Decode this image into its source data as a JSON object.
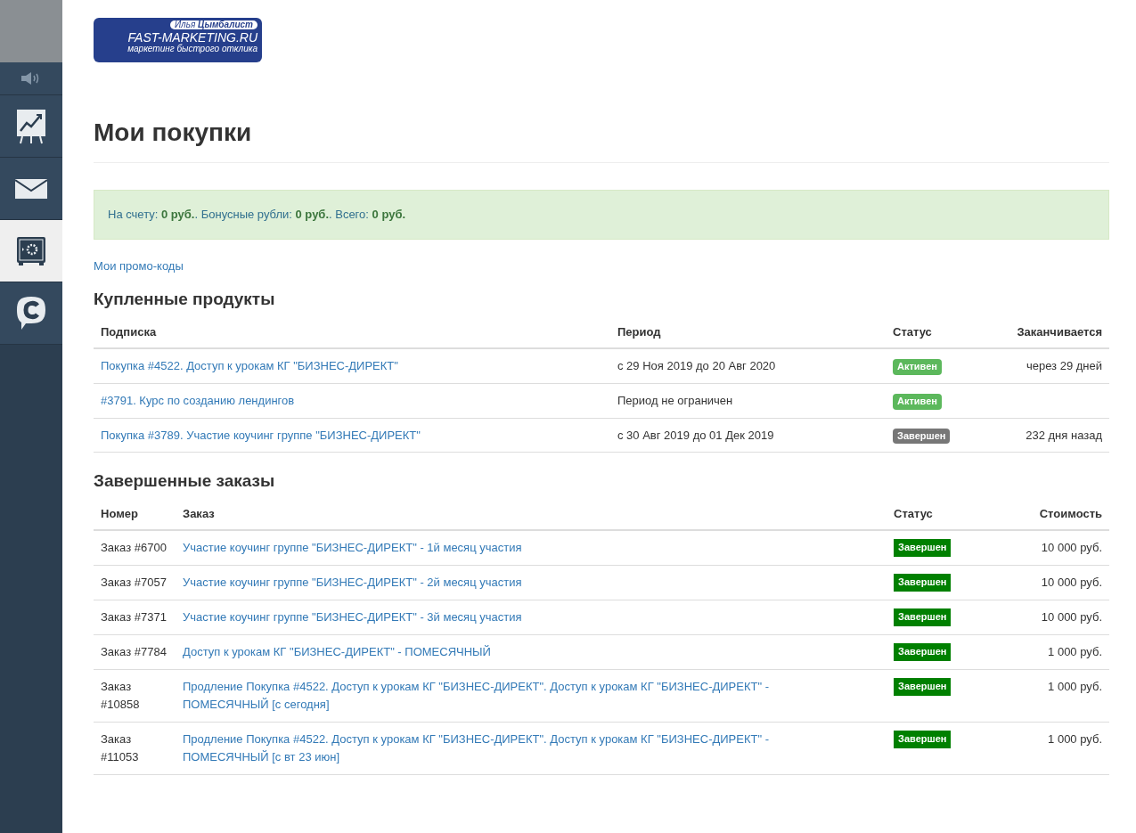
{
  "sidebar": {
    "items": [
      {
        "kind": "sound",
        "selected": false
      },
      {
        "kind": "chart",
        "selected": false
      },
      {
        "kind": "mail",
        "selected": false
      },
      {
        "kind": "safe",
        "selected": true
      },
      {
        "kind": "chat",
        "selected": false
      }
    ]
  },
  "logo": {
    "author": "Илья **Цымбалист**",
    "name": "FAST-MARKETING.RU",
    "tagline": "маркетинг быстрого отклика"
  },
  "title": "Мои покупки",
  "balance": "На счету: **0 руб.**. Бонусные рубли: **0 руб.**. Всего: **0 руб.**",
  "promo_link": "Мои промо-коды",
  "products": {
    "title": "Купленные продукты",
    "columns": [
      "Подписка",
      "Период",
      "Статус",
      "Заканчивается"
    ],
    "rows": [
      {
        "name": "Покупка #4522. Доступ к урокам КГ \"БИЗНЕС-ДИРЕКТ\"",
        "period": "с 29 Ноя 2019 до 20 Авг 2020",
        "status": {
          "label": "Активен",
          "kind": "active"
        },
        "ends": "через 29 дней"
      },
      {
        "name": "#3791. Курс по созданию лендингов",
        "period": "Период не ограничен",
        "status": {
          "label": "Активен",
          "kind": "active"
        }
      },
      {
        "name": "Покупка #3789. Участие коучинг группе \"БИЗНЕС-ДИРЕКТ\"",
        "period": "с 30 Авг 2019 до 01 Дек 2019",
        "status": {
          "label": "Завершен",
          "kind": "expired"
        },
        "ends": "232 дня назад"
      }
    ]
  },
  "orders": {
    "title": "Завершенные заказы",
    "columns": [
      "Номер",
      "Заказ",
      "Статус",
      "Стоимость"
    ],
    "rows": [
      {
        "number": "Заказ #6700",
        "order": "Участие коучинг группе \"БИЗНЕС-ДИРЕКТ\" - 1й месяц участия",
        "status": {
          "label": "Завершен",
          "kind": "done"
        },
        "price": "10 000 руб."
      },
      {
        "number": "Заказ #7057",
        "order": "Участие коучинг группе \"БИЗНЕС-ДИРЕКТ\" - 2й месяц участия",
        "status": {
          "label": "Завершен",
          "kind": "done"
        },
        "price": "10 000 руб."
      },
      {
        "number": "Заказ #7371",
        "order": "Участие коучинг группе \"БИЗНЕС-ДИРЕКТ\" - 3й месяц участия",
        "status": {
          "label": "Завершен",
          "kind": "done"
        },
        "price": "10 000 руб."
      },
      {
        "number": "Заказ #7784",
        "order": "Доступ к урокам КГ \"БИЗНЕС-ДИРЕКТ\" - ПОМЕСЯЧНЫЙ",
        "status": {
          "label": "Завершен",
          "kind": "done"
        },
        "price": "1 000 руб."
      },
      {
        "number": "Заказ #10858",
        "order": "Продление Покупка #4522. Доступ к урокам КГ \"БИЗНЕС-ДИРЕКТ\". Доступ к урокам КГ \"БИЗНЕС-ДИРЕКТ\" - ПОМЕСЯЧНЫЙ [с сегодня]",
        "status": {
          "label": "Завершен",
          "kind": "done"
        },
        "price": "1 000 руб."
      },
      {
        "number": "Заказ #11053",
        "order": "Продление Покупка #4522. Доступ к урокам КГ \"БИЗНЕС-ДИРЕКТ\". Доступ к урокам КГ \"БИЗНЕС-ДИРЕКТ\" - ПОМЕСЯЧНЫЙ [с вт 23 июн]",
        "status": {
          "label": "Завершен",
          "kind": "done"
        },
        "price": "1 000 руб."
      }
    ]
  }
}
